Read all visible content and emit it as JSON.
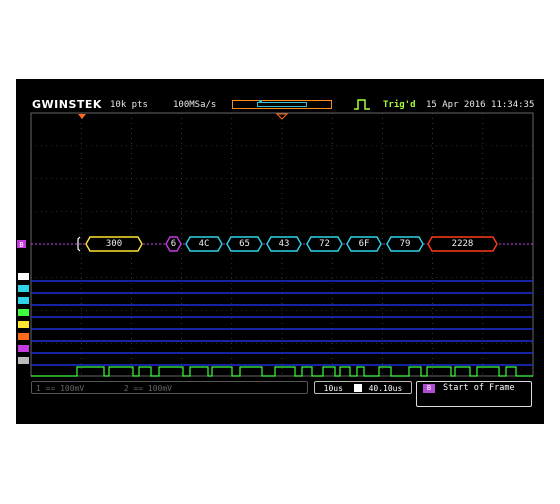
{
  "header": {
    "brand": "GWINSTEK",
    "memory_length": "10k pts",
    "sample_rate": "100MSa/s",
    "trigger_status": "Trig'd",
    "datetime": "15 Apr 2016 11:34:35"
  },
  "bus": {
    "channel_label": "B",
    "packets": [
      {
        "label": "300",
        "color": "#ffe433"
      },
      {
        "label": "6",
        "color": "#c33be0"
      },
      {
        "label": "4C",
        "color": "#2fd4e8"
      },
      {
        "label": "65",
        "color": "#2fd4e8"
      },
      {
        "label": "43",
        "color": "#2fd4e8"
      },
      {
        "label": "72",
        "color": "#2fd4e8"
      },
      {
        "label": "6F",
        "color": "#2fd4e8"
      },
      {
        "label": "79",
        "color": "#2fd4e8"
      },
      {
        "label": "2228",
        "color": "#ff3a1a"
      }
    ]
  },
  "digital_channels": {
    "count": 8,
    "trace_color": "#1f3cff",
    "active_trace_color": "#3dff3d"
  },
  "status_bar": {
    "ch1_scale": "1 == 100mV",
    "ch2_scale": "2 == 100mV",
    "timebase": "10us",
    "horizontal_position": "40.10us",
    "bus_trigger_badge": "B",
    "bus_trigger_condition": "Start of Frame"
  },
  "colors": {
    "grid": "#5a5a5a",
    "bus_line": "#c33be0",
    "trigger_marker": "#ff6a1a",
    "trigger_text": "#a8ff3a"
  }
}
